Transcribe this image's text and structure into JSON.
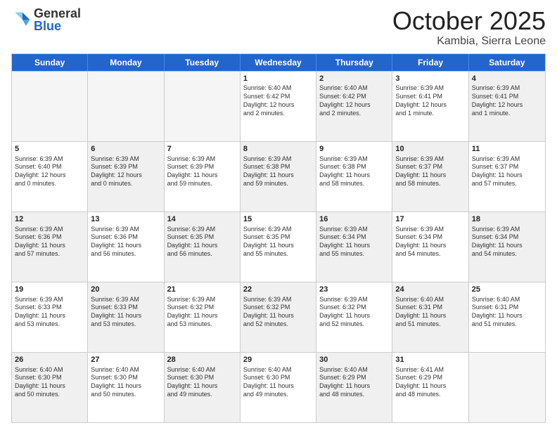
{
  "logo": {
    "general": "General",
    "blue": "Blue"
  },
  "header": {
    "month": "October 2025",
    "location": "Kambia, Sierra Leone"
  },
  "days": [
    "Sunday",
    "Monday",
    "Tuesday",
    "Wednesday",
    "Thursday",
    "Friday",
    "Saturday"
  ],
  "weeks": [
    [
      {
        "day": "",
        "info": "",
        "shaded": true,
        "empty": true
      },
      {
        "day": "",
        "info": "",
        "shaded": true,
        "empty": true
      },
      {
        "day": "",
        "info": "",
        "shaded": true,
        "empty": true
      },
      {
        "day": "1",
        "info": "Sunrise: 6:40 AM\nSunset: 6:42 PM\nDaylight: 12 hours\nand 2 minutes.",
        "shaded": false
      },
      {
        "day": "2",
        "info": "Sunrise: 6:40 AM\nSunset: 6:42 PM\nDaylight: 12 hours\nand 2 minutes.",
        "shaded": true
      },
      {
        "day": "3",
        "info": "Sunrise: 6:39 AM\nSunset: 6:41 PM\nDaylight: 12 hours\nand 1 minute.",
        "shaded": false
      },
      {
        "day": "4",
        "info": "Sunrise: 6:39 AM\nSunset: 6:41 PM\nDaylight: 12 hours\nand 1 minute.",
        "shaded": true
      }
    ],
    [
      {
        "day": "5",
        "info": "Sunrise: 6:39 AM\nSunset: 6:40 PM\nDaylight: 12 hours\nand 0 minutes.",
        "shaded": false
      },
      {
        "day": "6",
        "info": "Sunrise: 6:39 AM\nSunset: 6:39 PM\nDaylight: 12 hours\nand 0 minutes.",
        "shaded": true
      },
      {
        "day": "7",
        "info": "Sunrise: 6:39 AM\nSunset: 6:39 PM\nDaylight: 11 hours\nand 59 minutes.",
        "shaded": false
      },
      {
        "day": "8",
        "info": "Sunrise: 6:39 AM\nSunset: 6:38 PM\nDaylight: 11 hours\nand 59 minutes.",
        "shaded": true
      },
      {
        "day": "9",
        "info": "Sunrise: 6:39 AM\nSunset: 6:38 PM\nDaylight: 11 hours\nand 58 minutes.",
        "shaded": false
      },
      {
        "day": "10",
        "info": "Sunrise: 6:39 AM\nSunset: 6:37 PM\nDaylight: 11 hours\nand 58 minutes.",
        "shaded": true
      },
      {
        "day": "11",
        "info": "Sunrise: 6:39 AM\nSunset: 6:37 PM\nDaylight: 11 hours\nand 57 minutes.",
        "shaded": false
      }
    ],
    [
      {
        "day": "12",
        "info": "Sunrise: 6:39 AM\nSunset: 6:36 PM\nDaylight: 11 hours\nand 57 minutes.",
        "shaded": true
      },
      {
        "day": "13",
        "info": "Sunrise: 6:39 AM\nSunset: 6:36 PM\nDaylight: 11 hours\nand 56 minutes.",
        "shaded": false
      },
      {
        "day": "14",
        "info": "Sunrise: 6:39 AM\nSunset: 6:35 PM\nDaylight: 11 hours\nand 56 minutes.",
        "shaded": true
      },
      {
        "day": "15",
        "info": "Sunrise: 6:39 AM\nSunset: 6:35 PM\nDaylight: 11 hours\nand 55 minutes.",
        "shaded": false
      },
      {
        "day": "16",
        "info": "Sunrise: 6:39 AM\nSunset: 6:34 PM\nDaylight: 11 hours\nand 55 minutes.",
        "shaded": true
      },
      {
        "day": "17",
        "info": "Sunrise: 6:39 AM\nSunset: 6:34 PM\nDaylight: 11 hours\nand 54 minutes.",
        "shaded": false
      },
      {
        "day": "18",
        "info": "Sunrise: 6:39 AM\nSunset: 6:34 PM\nDaylight: 11 hours\nand 54 minutes.",
        "shaded": true
      }
    ],
    [
      {
        "day": "19",
        "info": "Sunrise: 6:39 AM\nSunset: 6:33 PM\nDaylight: 11 hours\nand 53 minutes.",
        "shaded": false
      },
      {
        "day": "20",
        "info": "Sunrise: 6:39 AM\nSunset: 6:33 PM\nDaylight: 11 hours\nand 53 minutes.",
        "shaded": true
      },
      {
        "day": "21",
        "info": "Sunrise: 6:39 AM\nSunset: 6:32 PM\nDaylight: 11 hours\nand 53 minutes.",
        "shaded": false
      },
      {
        "day": "22",
        "info": "Sunrise: 6:39 AM\nSunset: 6:32 PM\nDaylight: 11 hours\nand 52 minutes.",
        "shaded": true
      },
      {
        "day": "23",
        "info": "Sunrise: 6:39 AM\nSunset: 6:32 PM\nDaylight: 11 hours\nand 52 minutes.",
        "shaded": false
      },
      {
        "day": "24",
        "info": "Sunrise: 6:40 AM\nSunset: 6:31 PM\nDaylight: 11 hours\nand 51 minutes.",
        "shaded": true
      },
      {
        "day": "25",
        "info": "Sunrise: 6:40 AM\nSunset: 6:31 PM\nDaylight: 11 hours\nand 51 minutes.",
        "shaded": false
      }
    ],
    [
      {
        "day": "26",
        "info": "Sunrise: 6:40 AM\nSunset: 6:30 PM\nDaylight: 11 hours\nand 50 minutes.",
        "shaded": true
      },
      {
        "day": "27",
        "info": "Sunrise: 6:40 AM\nSunset: 6:30 PM\nDaylight: 11 hours\nand 50 minutes.",
        "shaded": false
      },
      {
        "day": "28",
        "info": "Sunrise: 6:40 AM\nSunset: 6:30 PM\nDaylight: 11 hours\nand 49 minutes.",
        "shaded": true
      },
      {
        "day": "29",
        "info": "Sunrise: 6:40 AM\nSunset: 6:30 PM\nDaylight: 11 hours\nand 49 minutes.",
        "shaded": false
      },
      {
        "day": "30",
        "info": "Sunrise: 6:40 AM\nSunset: 6:29 PM\nDaylight: 11 hours\nand 48 minutes.",
        "shaded": true
      },
      {
        "day": "31",
        "info": "Sunrise: 6:41 AM\nSunset: 6:29 PM\nDaylight: 11 hours\nand 48 minutes.",
        "shaded": false
      },
      {
        "day": "",
        "info": "",
        "shaded": true,
        "empty": true
      }
    ]
  ]
}
